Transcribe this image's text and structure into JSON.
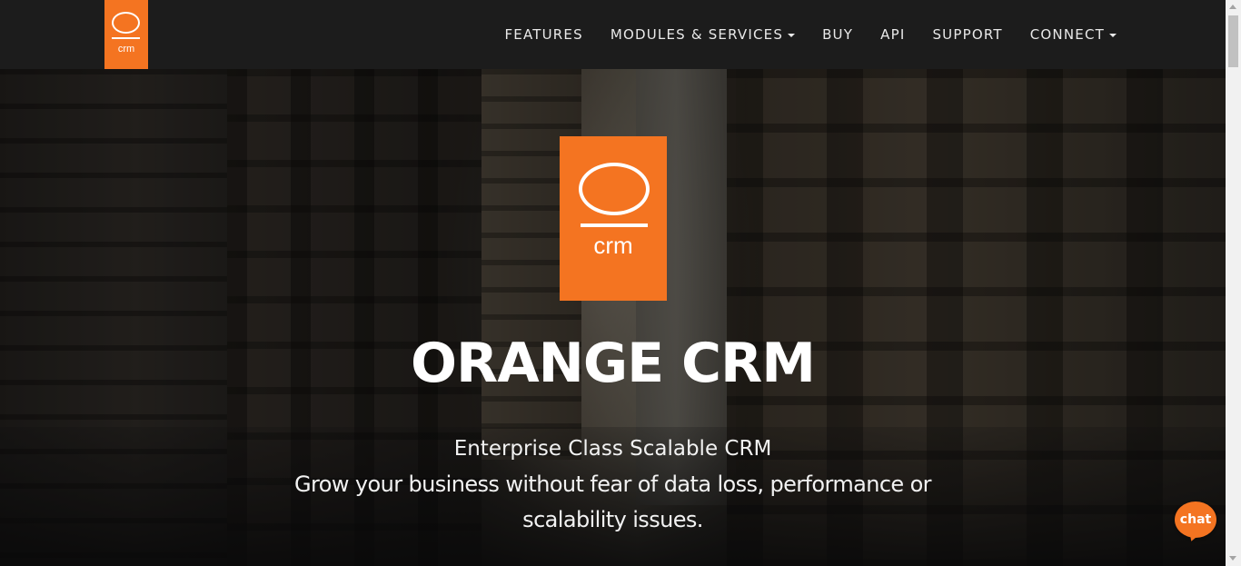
{
  "brand": {
    "logo_text": "crm",
    "accent_color": "#f47421"
  },
  "nav": {
    "items": [
      {
        "label": "FEATURES",
        "dropdown": false
      },
      {
        "label": "MODULES & SERVICES",
        "dropdown": true
      },
      {
        "label": "BUY",
        "dropdown": false
      },
      {
        "label": "API",
        "dropdown": false
      },
      {
        "label": "SUPPORT",
        "dropdown": false
      },
      {
        "label": "CONNECT",
        "dropdown": true
      }
    ]
  },
  "hero": {
    "logo_text": "crm",
    "title": "ORANGE CRM",
    "subtitle_line1": "Enterprise Class Scalable CRM",
    "subtitle_line2": "Grow your business without fear of data loss, performance or scalability issues."
  },
  "chat": {
    "label": "chat",
    "icon": "chat-bubble-icon"
  }
}
